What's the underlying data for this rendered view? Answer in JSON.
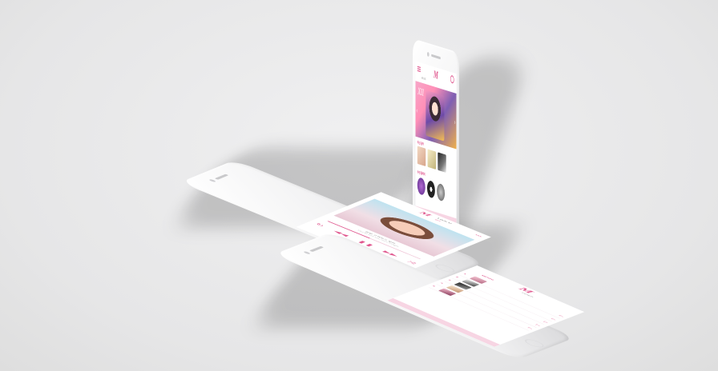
{
  "colors": {
    "accent": "#e0588f",
    "background": "#e9e9ea",
    "phone": "#f5f5f6"
  },
  "home": {
    "logo": "M",
    "tabs": [
      "MUSIC",
      "",
      ""
    ],
    "banner_badge": "XII",
    "sections": [
      "최신 음악",
      "추천 플레이"
    ],
    "bottom_icons": [
      "home-icon",
      "music-icon",
      "chart-icon",
      "user-icon"
    ]
  },
  "player": {
    "logo": "M",
    "song_title": "Love U",
    "artist": "청하",
    "lyric_line_1": "한번 고백하고 싶어",
    "lyric_line_2": "Please love you more tonight",
    "progress": 0.45,
    "controls": [
      "repeat-icon",
      "prev-icon",
      "pause-icon",
      "next-icon",
      "shuffle-icon"
    ]
  },
  "chart": {
    "logo": "M",
    "tabs": [
      "MUSIC",
      "VIDEO",
      ""
    ],
    "active_tab": 0,
    "items": [
      {
        "rank": "1",
        "title": "",
        "artist": ""
      },
      {
        "rank": "2",
        "title": "",
        "artist": ""
      },
      {
        "rank": "3",
        "title": "",
        "artist": ""
      },
      {
        "rank": "4",
        "title": "",
        "artist": ""
      },
      {
        "rank": "5",
        "title": "",
        "artist": ""
      }
    ]
  }
}
